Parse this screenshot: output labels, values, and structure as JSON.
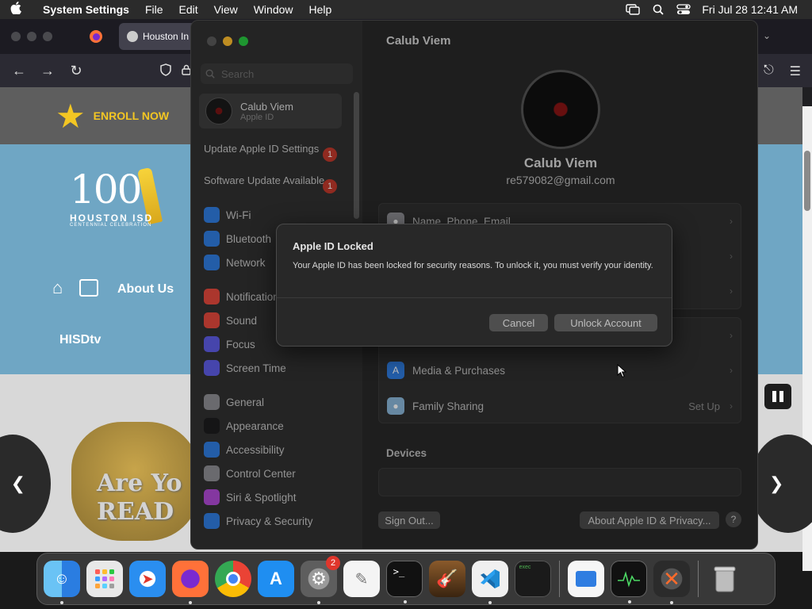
{
  "menubar": {
    "app_name": "System Settings",
    "menus": [
      "File",
      "Edit",
      "View",
      "Window",
      "Help"
    ],
    "clock": "Fri Jul 28  12:41 AM"
  },
  "browser": {
    "active_tab_title": "Houston In"
  },
  "webpage": {
    "enroll": "ENROLL NOW",
    "logo_number": "100",
    "logo_org": "HOUSTON ISD",
    "logo_sub": "CENTENNIAL CELEBRATION",
    "about_us": "About Us",
    "hisdtv": "HISDtv",
    "hero_text_1": "Are Yo",
    "hero_text_2": "READ"
  },
  "settings": {
    "search_placeholder": "Search",
    "apple_id": {
      "name": "Calub Viem",
      "sub": "Apple ID"
    },
    "notices": [
      {
        "label": "Update Apple ID Settings",
        "badge": "1"
      },
      {
        "label": "Software Update Available",
        "badge": "1"
      }
    ],
    "sidebar_items": [
      {
        "label": "Wi-Fi",
        "icon": "wifi-icon",
        "color": "#2f7de1"
      },
      {
        "label": "Bluetooth",
        "icon": "bluetooth-icon",
        "color": "#2f7de1"
      },
      {
        "label": "Network",
        "icon": "globe-icon",
        "color": "#2f7de1"
      },
      {
        "label": "Notifications",
        "icon": "bell-icon",
        "color": "#e5483c"
      },
      {
        "label": "Sound",
        "icon": "speaker-icon",
        "color": "#e5483c"
      },
      {
        "label": "Focus",
        "icon": "moon-icon",
        "color": "#5e5ce6"
      },
      {
        "label": "Screen Time",
        "icon": "hourglass-icon",
        "color": "#5e5ce6"
      },
      {
        "label": "General",
        "icon": "gear-icon",
        "color": "#8e8e93"
      },
      {
        "label": "Appearance",
        "icon": "appearance-icon",
        "color": "#1c1c1e"
      },
      {
        "label": "Accessibility",
        "icon": "accessibility-icon",
        "color": "#2f7de1"
      },
      {
        "label": "Control Center",
        "icon": "control-center-icon",
        "color": "#8e8e93"
      },
      {
        "label": "Siri & Spotlight",
        "icon": "siri-icon",
        "color": "#b04ad6"
      },
      {
        "label": "Privacy & Security",
        "icon": "hand-icon",
        "color": "#2f7de1"
      }
    ],
    "content": {
      "title": "Calub Viem",
      "name": "Calub Viem",
      "email": "re579082@gmail.com",
      "rows_group1": [
        "Name, Phone, Email"
      ],
      "media_row": "Media & Purchases",
      "family_row": "Family Sharing",
      "family_value": "Set Up",
      "devices_label": "Devices",
      "sign_out": "Sign Out...",
      "about_privacy": "About Apple ID & Privacy...",
      "help": "?"
    }
  },
  "dialog": {
    "title": "Apple ID Locked",
    "message": "Your Apple ID has been locked for security reasons. To unlock it, you must verify your identity.",
    "cancel": "Cancel",
    "unlock": "Unlock Account"
  },
  "dock": {
    "settings_badge": "2"
  }
}
